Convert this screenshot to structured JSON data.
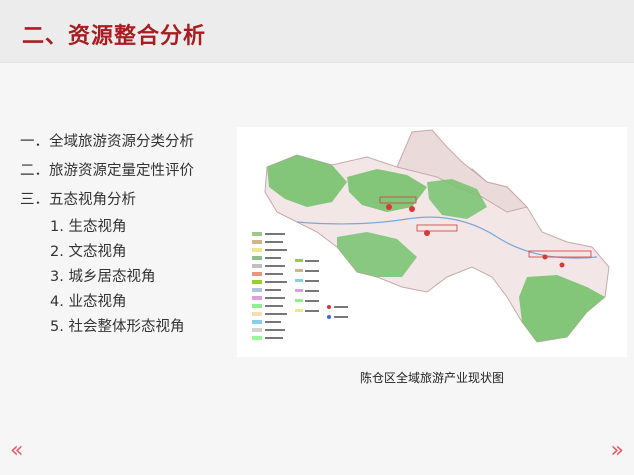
{
  "slide": {
    "title": "二、资源整合分析",
    "outline": [
      "一．全域旅游资源分类分析",
      "二．旅游资源定量定性评价",
      "三．五态视角分析"
    ],
    "sub_items": [
      "1. 生态视角",
      "2. 文态视角",
      "3. 城乡居态视角",
      "4. 业态视角",
      "5. 社会整体形态视角"
    ],
    "map_caption": "陈仓区全域旅游产业现状图",
    "nav": {
      "prev": "«",
      "next": "»"
    }
  },
  "colors": {
    "title": "#a71d22",
    "nav": "#e25a62",
    "map_green": "#77c26d",
    "map_land": "#f2e6e6",
    "map_red": "#d33a3a"
  }
}
